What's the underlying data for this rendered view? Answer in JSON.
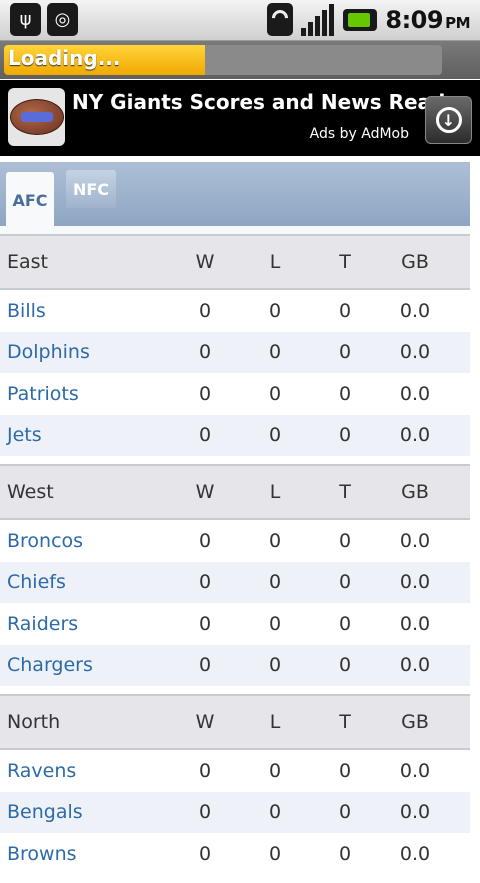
{
  "status_bar": {
    "icons": [
      "usb-icon",
      "android-debug-icon",
      "wifi-icon",
      "signal-icon",
      "battery-charging-icon"
    ],
    "time": "8:09",
    "ampm": "PM"
  },
  "loading": {
    "label": "Loading...",
    "progress": 0.46
  },
  "ad": {
    "title": "NY Giants Scores and News Reader",
    "subtitle": "Ads by AdMob",
    "logo_icon": "football-logo-icon",
    "download_icon": "download-arrow-icon"
  },
  "tabs": [
    {
      "label": "AFC",
      "active": true
    },
    {
      "label": "NFC",
      "active": false
    }
  ],
  "columns": {
    "w": "W",
    "l": "L",
    "t": "T",
    "gb": "GB"
  },
  "divisions": [
    {
      "name": "East",
      "teams": [
        {
          "name": "Bills",
          "w": "0",
          "l": "0",
          "t": "0",
          "gb": "0.0"
        },
        {
          "name": "Dolphins",
          "w": "0",
          "l": "0",
          "t": "0",
          "gb": "0.0"
        },
        {
          "name": "Patriots",
          "w": "0",
          "l": "0",
          "t": "0",
          "gb": "0.0"
        },
        {
          "name": "Jets",
          "w": "0",
          "l": "0",
          "t": "0",
          "gb": "0.0"
        }
      ]
    },
    {
      "name": "West",
      "teams": [
        {
          "name": "Broncos",
          "w": "0",
          "l": "0",
          "t": "0",
          "gb": "0.0"
        },
        {
          "name": "Chiefs",
          "w": "0",
          "l": "0",
          "t": "0",
          "gb": "0.0"
        },
        {
          "name": "Raiders",
          "w": "0",
          "l": "0",
          "t": "0",
          "gb": "0.0"
        },
        {
          "name": "Chargers",
          "w": "0",
          "l": "0",
          "t": "0",
          "gb": "0.0"
        }
      ]
    },
    {
      "name": "North",
      "teams": [
        {
          "name": "Ravens",
          "w": "0",
          "l": "0",
          "t": "0",
          "gb": "0.0"
        },
        {
          "name": "Bengals",
          "w": "0",
          "l": "0",
          "t": "0",
          "gb": "0.0"
        },
        {
          "name": "Browns",
          "w": "0",
          "l": "0",
          "t": "0",
          "gb": "0.0"
        }
      ]
    }
  ],
  "colors": {
    "team_link": "#2c6aa8",
    "progress": "#f5b400",
    "tab_bg": "#8ea6c3"
  }
}
